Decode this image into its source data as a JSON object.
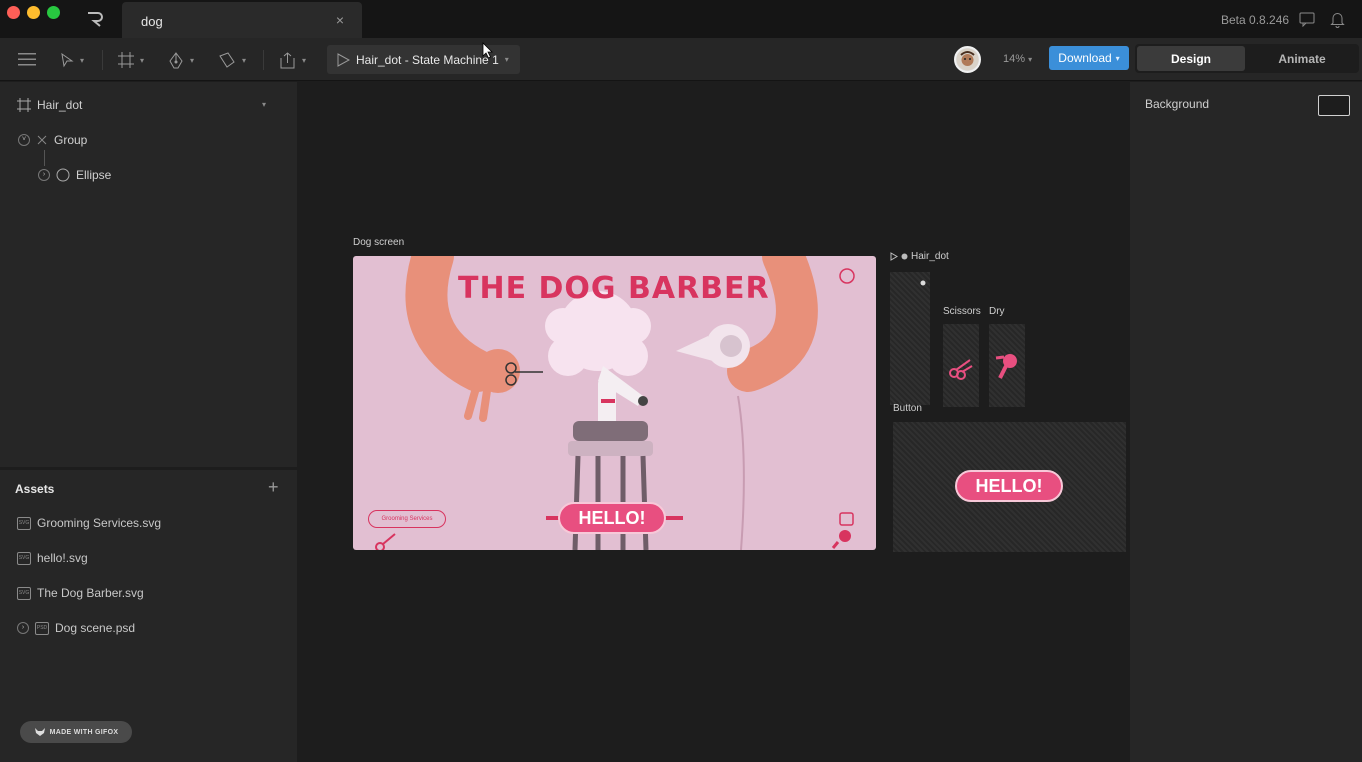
{
  "titlebar": {
    "tab_title": "dog",
    "close_glyph": "×",
    "version": "Beta 0.8.246",
    "icons": [
      "app-logo-icon",
      "feedback-icon",
      "notification-bell-icon"
    ]
  },
  "toolbar": {
    "state_machine_label": "Hair_dot - State Machine 1",
    "zoom_label": "14%",
    "download_label": "Download",
    "mode_design": "Design",
    "mode_animate": "Animate",
    "accent_color": "#3b8fd9",
    "tools": [
      "menu-icon",
      "select-tool-icon",
      "artboard-tool-icon",
      "pen-tool-icon",
      "paint-tool-icon",
      "export-icon",
      "play-icon"
    ]
  },
  "hierarchy": {
    "artboard_name": "Hair_dot",
    "items": [
      {
        "label": "Group"
      },
      {
        "label": "Ellipse"
      }
    ]
  },
  "assets": {
    "title": "Assets",
    "add_glyph": "+",
    "files": [
      {
        "name": "Grooming Services.svg",
        "type": "SVG"
      },
      {
        "name": "hello!.svg",
        "type": "SVG"
      },
      {
        "name": "The Dog Barber.svg",
        "type": "SVG"
      },
      {
        "name": "Dog scene.psd",
        "type": "PSD"
      }
    ],
    "badge": "MADE WITH GIFOX"
  },
  "canvas": {
    "artboard_label": "Dog screen",
    "artboard_title": "THE DOG BARBER",
    "grooming_button": "Grooming Services",
    "hello_button": "HELLO!",
    "hair_dot_label": "Hair_dot",
    "scissors_label": "Scissors",
    "dry_label": "Dry",
    "button_label": "Button",
    "preview_hello": "HELLO!"
  },
  "properties": {
    "background_label": "Background"
  }
}
